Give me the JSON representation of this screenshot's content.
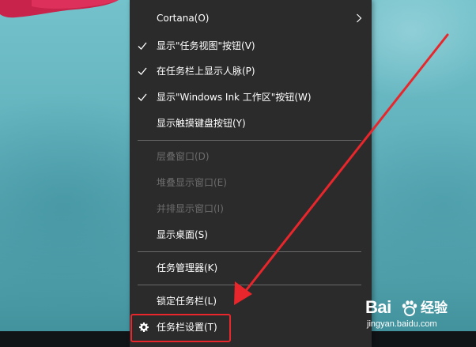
{
  "context_menu": {
    "items": [
      {
        "label": "Cortana(O)",
        "checked": false,
        "submenu": true,
        "disabled": false
      },
      {
        "label": "显示\"任务视图\"按钮(V)",
        "checked": true,
        "submenu": false,
        "disabled": false
      },
      {
        "label": "在任务栏上显示人脉(P)",
        "checked": true,
        "submenu": false,
        "disabled": false
      },
      {
        "label": "显示\"Windows Ink 工作区\"按钮(W)",
        "checked": true,
        "submenu": false,
        "disabled": false
      },
      {
        "label": "显示触摸键盘按钮(Y)",
        "checked": false,
        "submenu": false,
        "disabled": false
      },
      {
        "label": "层叠窗口(D)",
        "checked": false,
        "submenu": false,
        "disabled": true
      },
      {
        "label": "堆叠显示窗口(E)",
        "checked": false,
        "submenu": false,
        "disabled": true
      },
      {
        "label": "并排显示窗口(I)",
        "checked": false,
        "submenu": false,
        "disabled": true
      },
      {
        "label": "显示桌面(S)",
        "checked": false,
        "submenu": false,
        "disabled": false
      },
      {
        "label": "任务管理器(K)",
        "checked": false,
        "submenu": false,
        "disabled": false
      },
      {
        "label": "锁定任务栏(L)",
        "checked": false,
        "submenu": false,
        "disabled": false
      },
      {
        "label": "任务栏设置(T)",
        "checked": false,
        "submenu": false,
        "disabled": false,
        "icon": "gear-icon",
        "highlighted": true
      }
    ]
  },
  "watermark": {
    "logo_text": "Bai",
    "logo_icon": "paw-icon",
    "cn_text": "经验",
    "url": "jingyan.baidu.com"
  },
  "annotation": {
    "arrow_color": "#e8262b",
    "highlight_color": "#e8262b"
  },
  "colors": {
    "menu_bg": "#2b2b2b",
    "menu_text": "#ffffff",
    "disabled_text": "#6d6d6d",
    "separator": "#6a6a6a",
    "taskbar": "#111417"
  }
}
